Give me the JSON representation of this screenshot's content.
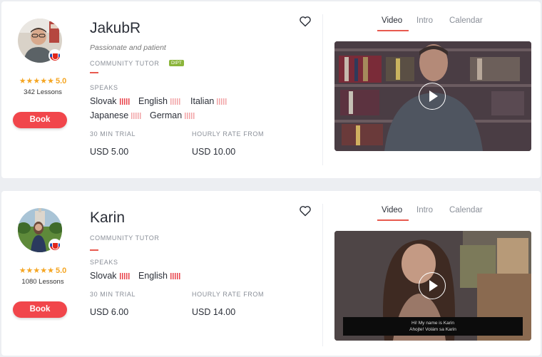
{
  "tutors": [
    {
      "name": "JakubR",
      "tagline": "Passionate and patient",
      "role": "COMMUNITY TUTOR",
      "badge": "DIPT",
      "rating": "5.0",
      "stars": "★★★★★",
      "lessons": "342 Lessons",
      "book_label": "Book",
      "speaks_label": "SPEAKS",
      "languages": [
        "Slovak",
        "English",
        "Italian",
        "Japanese",
        "German"
      ],
      "native_language": "Slovak",
      "trial_label": "30 MIN TRIAL",
      "trial_price": "USD 5.00",
      "rate_label": "HOURLY RATE FROM",
      "rate_price": "USD 10.00",
      "tabs": [
        "Video",
        "Intro",
        "Calendar"
      ],
      "active_tab": "Video",
      "flag_icon": "slovakia-flag-icon"
    },
    {
      "name": "Karin",
      "tagline": "",
      "role": "COMMUNITY TUTOR",
      "rating": "5.0",
      "stars": "★★★★★",
      "lessons": "1080 Lessons",
      "book_label": "Book",
      "speaks_label": "SPEAKS",
      "languages": [
        "Slovak",
        "English"
      ],
      "native_language": "Slovak",
      "trial_label": "30 MIN TRIAL",
      "trial_price": "USD 6.00",
      "rate_label": "HOURLY RATE FROM",
      "rate_price": "USD 14.00",
      "tabs": [
        "Video",
        "Intro",
        "Calendar"
      ],
      "active_tab": "Video",
      "subtitle_line1": "Hi! My name is Karin",
      "subtitle_line2": "Ahojte! Volám sa Karin",
      "flag_icon": "slovakia-flag-icon"
    }
  ],
  "colors": {
    "accent": "#f1464b",
    "star": "#f5a623",
    "badge": "#8bb53b",
    "background": "#eceef2"
  }
}
